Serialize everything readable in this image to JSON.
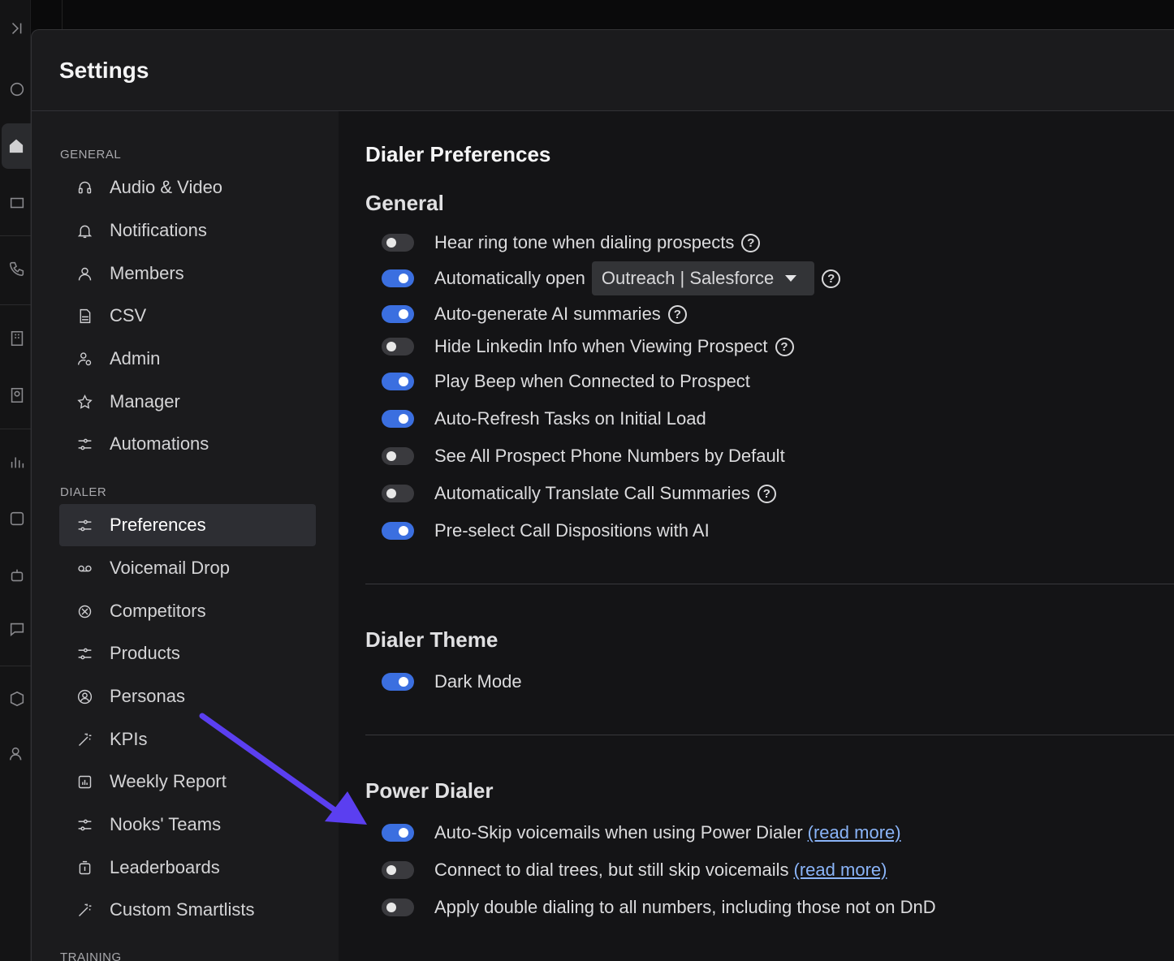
{
  "modal": {
    "title": "Settings"
  },
  "sidebar": {
    "sections": [
      {
        "label": "GENERAL"
      },
      {
        "label": "DIALER"
      },
      {
        "label": "TRAINING"
      }
    ],
    "items": [
      {
        "label": "Audio & Video",
        "icon": "headset-icon"
      },
      {
        "label": "Notifications",
        "icon": "bell-icon"
      },
      {
        "label": "Members",
        "icon": "user-icon"
      },
      {
        "label": "CSV",
        "icon": "csv-file-icon"
      },
      {
        "label": "Admin",
        "icon": "admin-icon"
      },
      {
        "label": "Manager",
        "icon": "star-icon"
      },
      {
        "label": "Automations",
        "icon": "sliders-icon"
      },
      {
        "label": "Preferences",
        "icon": "sliders-icon",
        "active": true
      },
      {
        "label": "Voicemail Drop",
        "icon": "voicemail-icon"
      },
      {
        "label": "Competitors",
        "icon": "competitors-icon"
      },
      {
        "label": "Products",
        "icon": "sliders-icon"
      },
      {
        "label": "Personas",
        "icon": "persona-icon"
      },
      {
        "label": "KPIs",
        "icon": "magic-wand-icon"
      },
      {
        "label": "Weekly Report",
        "icon": "report-chart-icon"
      },
      {
        "label": "Nooks' Teams",
        "icon": "sliders-icon"
      },
      {
        "label": "Leaderboards",
        "icon": "trophy-icon"
      },
      {
        "label": "Custom Smartlists",
        "icon": "magic-wand-icon"
      }
    ]
  },
  "content": {
    "title": "Dialer Preferences",
    "general": {
      "heading": "General",
      "dropdown_value": "Outreach | Salesforce",
      "help_glyph": "?",
      "rows": [
        {
          "label": "Hear ring tone when dialing prospects",
          "on": false
        },
        {
          "label": "Automatically open",
          "on": true
        },
        {
          "label": "Auto-generate AI summaries",
          "on": true
        },
        {
          "label": "Hide Linkedin Info when Viewing Prospect",
          "on": false
        },
        {
          "label": "Play Beep when Connected to Prospect",
          "on": true
        },
        {
          "label": "Auto-Refresh Tasks on Initial Load",
          "on": true
        },
        {
          "label": "See All Prospect Phone Numbers by Default",
          "on": false
        },
        {
          "label": "Automatically Translate Call Summaries",
          "on": false
        },
        {
          "label": "Pre-select Call Dispositions with AI",
          "on": true
        }
      ]
    },
    "theme": {
      "heading": "Dialer Theme",
      "rows": [
        {
          "label": "Dark Mode",
          "on": true
        }
      ]
    },
    "power_dialer": {
      "heading": "Power Dialer",
      "link_label": "(read more)",
      "rows": [
        {
          "label": "Auto-Skip voicemails when using Power Dialer",
          "on": true
        },
        {
          "label": "Connect to dial trees, but still skip voicemails",
          "on": false
        },
        {
          "label": "Apply double dialing to all numbers, including those not on DnD",
          "on": false
        }
      ]
    }
  },
  "colors": {
    "accent": "#3b6fe0",
    "annotation_arrow": "#5b3ff0",
    "link": "#8ab4f8"
  }
}
